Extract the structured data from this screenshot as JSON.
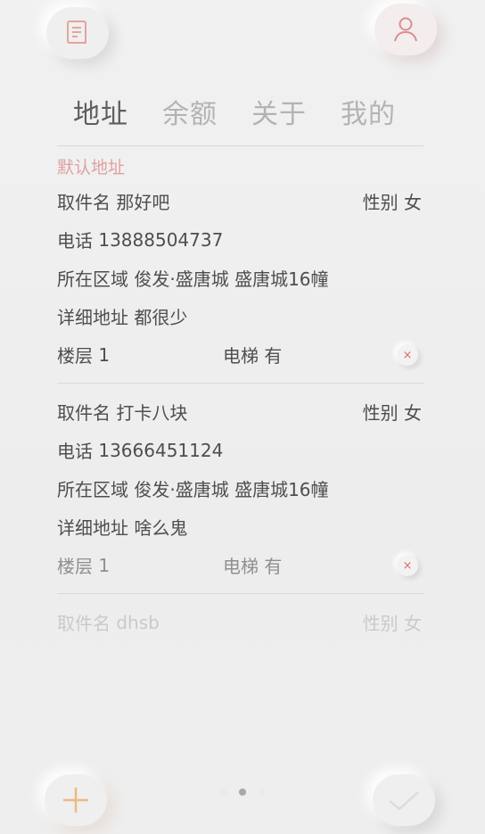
{
  "tabs": [
    "地址",
    "余额",
    "关于",
    "我的"
  ],
  "default_label": "默认地址",
  "labels": {
    "name": "取件名",
    "gender": "性别",
    "phone": "电话",
    "area": "所在区域",
    "detail": "详细地址",
    "floor": "楼层",
    "elevator": "电梯"
  },
  "addresses": [
    {
      "name": "那好吧",
      "gender": "女",
      "phone": "13888504737",
      "area": "俊发·盛唐城 盛唐城16幢",
      "detail": "都很少",
      "floor": "1",
      "elevator": "有"
    },
    {
      "name": "打卡八块",
      "gender": "女",
      "phone": "13666451124",
      "area": "俊发·盛唐城 盛唐城16幢",
      "detail": "啥么鬼",
      "floor": "1",
      "elevator": "有"
    },
    {
      "name": "dhsb",
      "gender": "女"
    }
  ],
  "delete_glyph": "×",
  "colors": {
    "accent": "#e0a0a0",
    "user_icon": "#d98f8f",
    "doc_icon": "#e3a59a",
    "add_icon": "#eeb982",
    "check_icon": "#dcdcdc"
  },
  "pager": {
    "pages": 3,
    "active": 1
  }
}
